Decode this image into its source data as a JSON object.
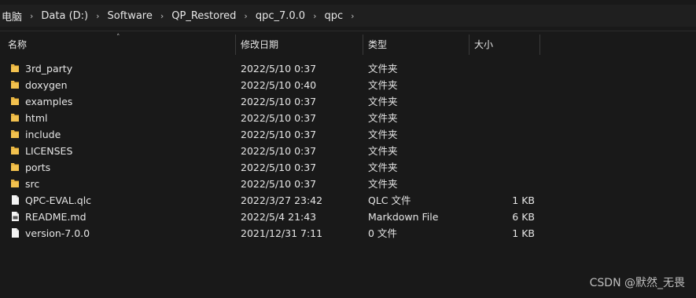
{
  "breadcrumb": [
    "电脑",
    "Data (D:)",
    "Software",
    "QP_Restored",
    "qpc_7.0.0",
    "qpc"
  ],
  "breadcrumb_separator": "›",
  "columns": {
    "name": "名称",
    "date": "修改日期",
    "type": "类型",
    "size": "大小"
  },
  "sort_indicator": "˄",
  "rows": [
    {
      "name": "3rd_party",
      "date": "2022/5/10 0:37",
      "type": "文件夹",
      "size": "",
      "icon": "folder-icon"
    },
    {
      "name": "doxygen",
      "date": "2022/5/10 0:40",
      "type": "文件夹",
      "size": "",
      "icon": "folder-icon"
    },
    {
      "name": "examples",
      "date": "2022/5/10 0:37",
      "type": "文件夹",
      "size": "",
      "icon": "folder-icon"
    },
    {
      "name": "html",
      "date": "2022/5/10 0:37",
      "type": "文件夹",
      "size": "",
      "icon": "folder-icon"
    },
    {
      "name": "include",
      "date": "2022/5/10 0:37",
      "type": "文件夹",
      "size": "",
      "icon": "folder-icon"
    },
    {
      "name": "LICENSES",
      "date": "2022/5/10 0:37",
      "type": "文件夹",
      "size": "",
      "icon": "folder-icon"
    },
    {
      "name": "ports",
      "date": "2022/5/10 0:37",
      "type": "文件夹",
      "size": "",
      "icon": "folder-icon"
    },
    {
      "name": "src",
      "date": "2022/5/10 0:37",
      "type": "文件夹",
      "size": "",
      "icon": "folder-icon"
    },
    {
      "name": "QPC-EVAL.qlc",
      "date": "2022/3/27 23:42",
      "type": "QLC 文件",
      "size": "1 KB",
      "icon": "file-icon"
    },
    {
      "name": "README.md",
      "date": "2022/5/4 21:43",
      "type": "Markdown File",
      "size": "6 KB",
      "icon": "markdown-file-icon"
    },
    {
      "name": "version-7.0.0",
      "date": "2021/12/31 7:11",
      "type": "0 文件",
      "size": "1 KB",
      "icon": "file-icon"
    }
  ],
  "watermark": "CSDN @默然_无畏",
  "colors": {
    "background": "#191919",
    "text": "#e6e6e6",
    "folder": "#f2c14e"
  }
}
